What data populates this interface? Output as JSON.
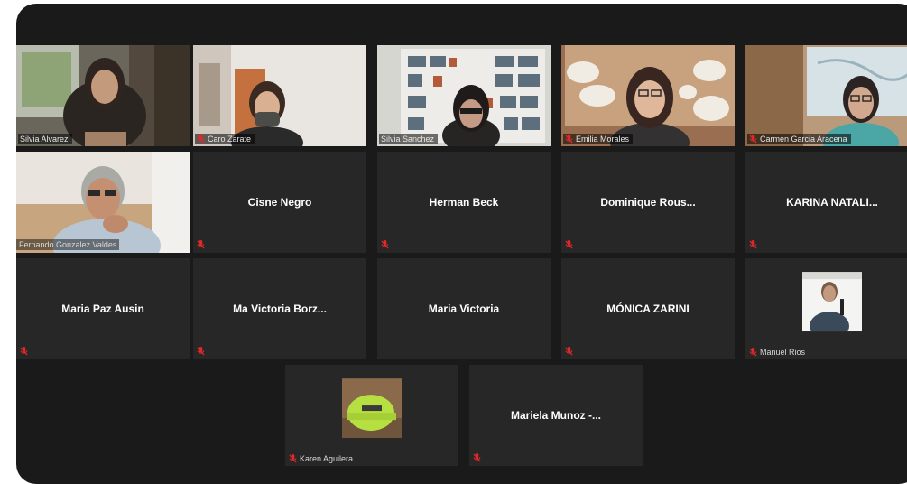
{
  "meeting": {
    "participants": [
      {
        "name": "Silvia Alvarez",
        "video": true
      },
      {
        "name": "Caro Zarate",
        "video": true
      },
      {
        "name": "Silvia Sanchez",
        "video": true
      },
      {
        "name": "Emilia Morales",
        "video": true
      },
      {
        "name": "Carmen Garcia Aracena",
        "video": true
      },
      {
        "name": "Fernando Gonzalez Valdes",
        "video": true
      },
      {
        "name": "Cisne Negro",
        "video": false
      },
      {
        "name": "Herman Beck",
        "video": false
      },
      {
        "name": "Dominique Rous...",
        "video": false
      },
      {
        "name": "KARINA NATALI...",
        "video": false
      },
      {
        "name": "Maria Paz Ausin",
        "video": false
      },
      {
        "name": "Ma Victoria Borz...",
        "video": false
      },
      {
        "name": "Maria Victoria",
        "video": false
      },
      {
        "name": "MÓNICA ZARINI",
        "video": false
      },
      {
        "name": "Manuel Rios",
        "video": false,
        "avatar": "presenter-photo"
      },
      {
        "name": "Karen Aguilera",
        "video": false,
        "avatar": "hard-hat-photo"
      },
      {
        "name": "Mariela Munoz -...",
        "video": false
      }
    ],
    "colors": {
      "background": "#1a1a1a",
      "tile": "#272727",
      "active_speaker_border": "#c8e35a",
      "muted_icon": "#e02828"
    }
  }
}
